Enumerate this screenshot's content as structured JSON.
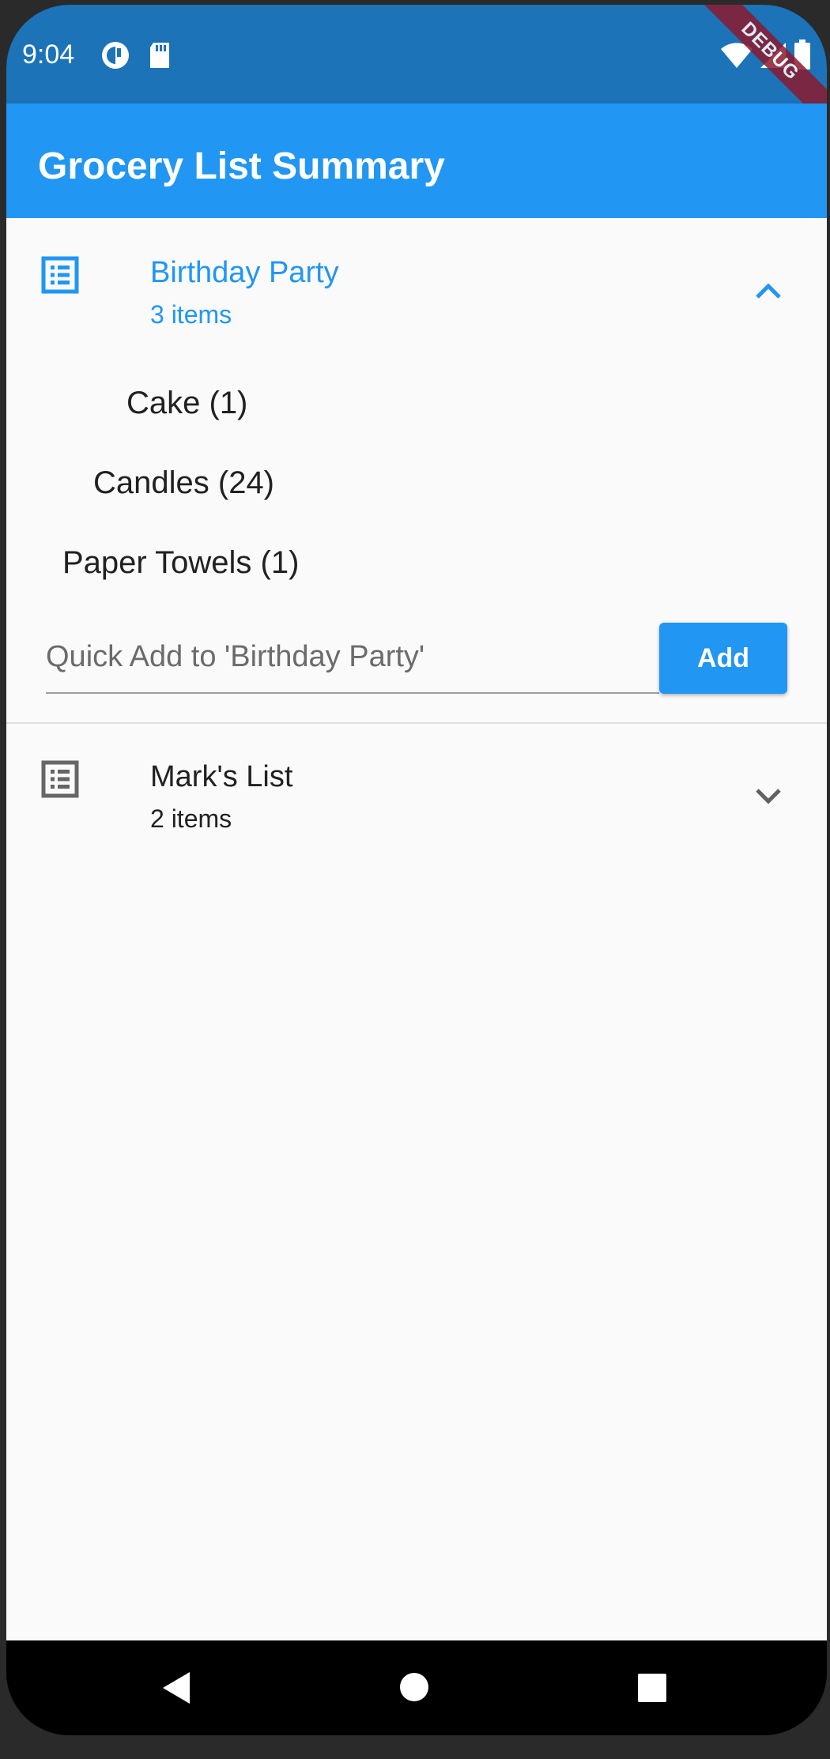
{
  "status_bar": {
    "time": "9:04",
    "icons": [
      "app-notification-icon",
      "sd-card-icon",
      "wifi-icon",
      "signal-icon",
      "battery-icon"
    ],
    "debug_banner": "DEBUG"
  },
  "app_bar": {
    "title": "Grocery List Summary"
  },
  "lists": [
    {
      "title": "Birthday Party",
      "subtitle": "3 items",
      "expanded": true,
      "accent": "#2196f3",
      "icon": "list-icon",
      "items": [
        "Cake (1)",
        "Candles (24)",
        "Paper Towels (1)"
      ],
      "quick_add_placeholder": "Quick Add to 'Birthday Party'",
      "add_label": "Add"
    },
    {
      "title": "Mark's List",
      "subtitle": "2 items",
      "expanded": false,
      "icon": "list-icon"
    }
  ],
  "nav_bar": {
    "icons": [
      "back-icon",
      "home-icon",
      "recents-icon"
    ]
  },
  "colors": {
    "primary": "#2196f3",
    "status_bar": "#1c73b8",
    "background": "#fafafa"
  }
}
